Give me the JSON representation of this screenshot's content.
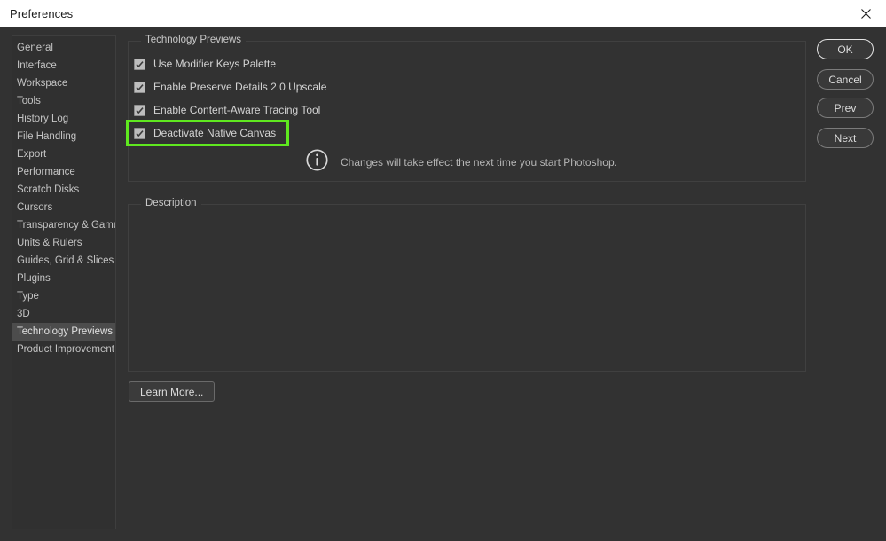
{
  "window": {
    "title": "Preferences",
    "close_icon": "close-icon"
  },
  "sidebar": {
    "items": [
      {
        "label": "General",
        "selected": false
      },
      {
        "label": "Interface",
        "selected": false
      },
      {
        "label": "Workspace",
        "selected": false
      },
      {
        "label": "Tools",
        "selected": false
      },
      {
        "label": "History Log",
        "selected": false
      },
      {
        "label": "File Handling",
        "selected": false
      },
      {
        "label": "Export",
        "selected": false
      },
      {
        "label": "Performance",
        "selected": false
      },
      {
        "label": "Scratch Disks",
        "selected": false
      },
      {
        "label": "Cursors",
        "selected": false
      },
      {
        "label": "Transparency & Gamut",
        "selected": false
      },
      {
        "label": "Units & Rulers",
        "selected": false
      },
      {
        "label": "Guides, Grid & Slices",
        "selected": false
      },
      {
        "label": "Plugins",
        "selected": false
      },
      {
        "label": "Type",
        "selected": false
      },
      {
        "label": "3D",
        "selected": false
      },
      {
        "label": "Technology Previews",
        "selected": true
      },
      {
        "label": "Product Improvement",
        "selected": false
      }
    ]
  },
  "tech_previews": {
    "group_title": "Technology Previews",
    "checkboxes": [
      {
        "label": "Use Modifier Keys Palette",
        "checked": true,
        "highlighted": false
      },
      {
        "label": "Enable Preserve Details 2.0 Upscale",
        "checked": true,
        "highlighted": false
      },
      {
        "label": "Enable Content-Aware Tracing Tool",
        "checked": true,
        "highlighted": false
      },
      {
        "label": "Deactivate Native Canvas",
        "checked": true,
        "highlighted": true
      }
    ],
    "note": {
      "icon": "info-icon",
      "text": "Changes will take effect the next time you start Photoshop."
    },
    "highlight_color": "#5fe81f"
  },
  "description": {
    "group_title": "Description",
    "body": ""
  },
  "buttons": {
    "ok": "OK",
    "cancel": "Cancel",
    "prev": "Prev",
    "next": "Next",
    "learn_more": "Learn More..."
  }
}
